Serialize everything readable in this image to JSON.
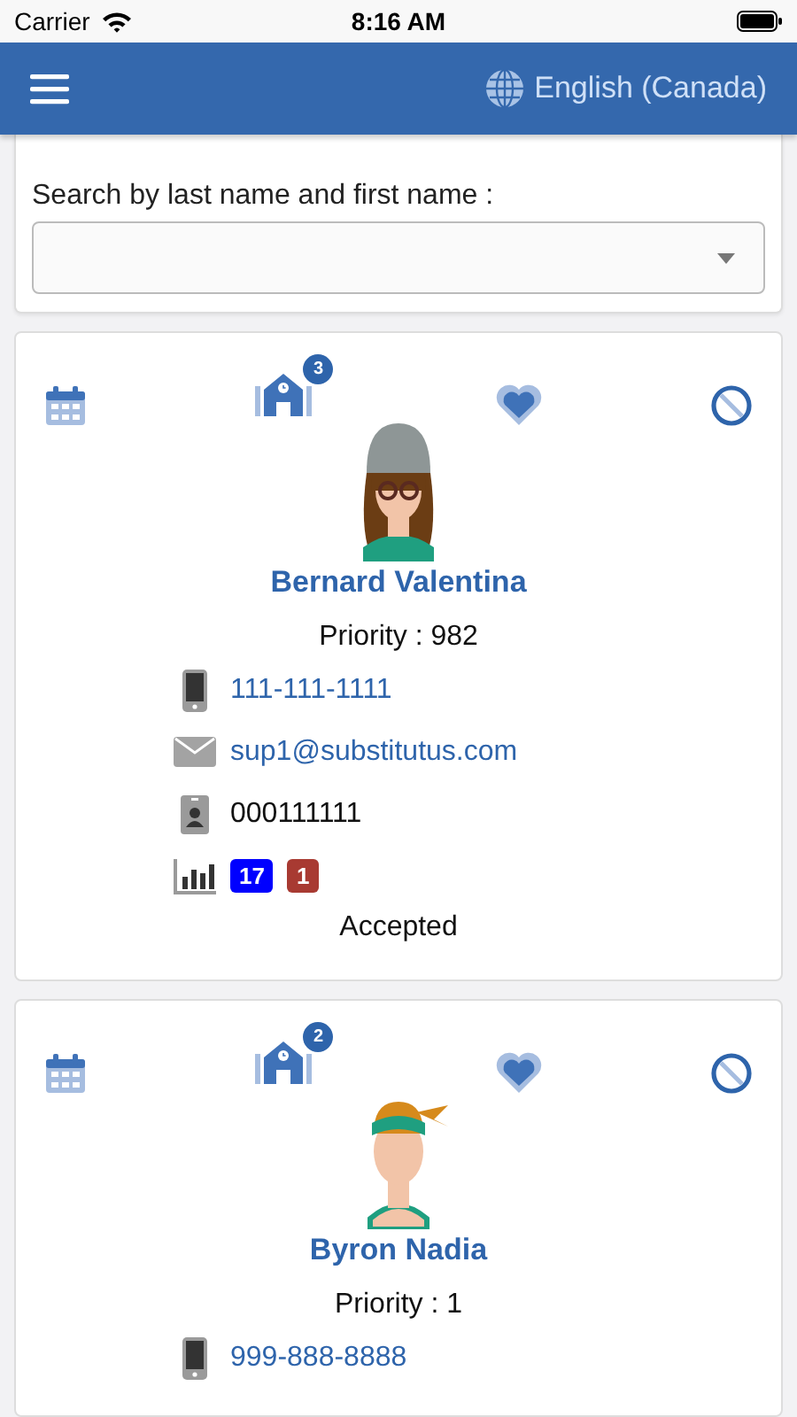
{
  "status_bar": {
    "carrier": "Carrier",
    "time": "8:16 AM"
  },
  "header": {
    "language": "English (Canada)"
  },
  "search": {
    "label": "Search by last name and first name :"
  },
  "substitutes": [
    {
      "avatar": {
        "kind": "beanie"
      },
      "schools_count": "3",
      "name": "Bernard Valentina",
      "priority": "Priority : 982",
      "phone": "111-111-1111",
      "email": "sup1@substitutus.com",
      "id_number": "000111111",
      "stats": [
        {
          "value": "17",
          "color": "#0000ff"
        },
        {
          "value": "1",
          "color": "#a83a32"
        }
      ],
      "status": "Accepted"
    },
    {
      "avatar": {
        "kind": "headband"
      },
      "schools_count": "2",
      "name": "Byron Nadia",
      "priority": "Priority : 1",
      "phone": "999-888-8888"
    }
  ]
}
